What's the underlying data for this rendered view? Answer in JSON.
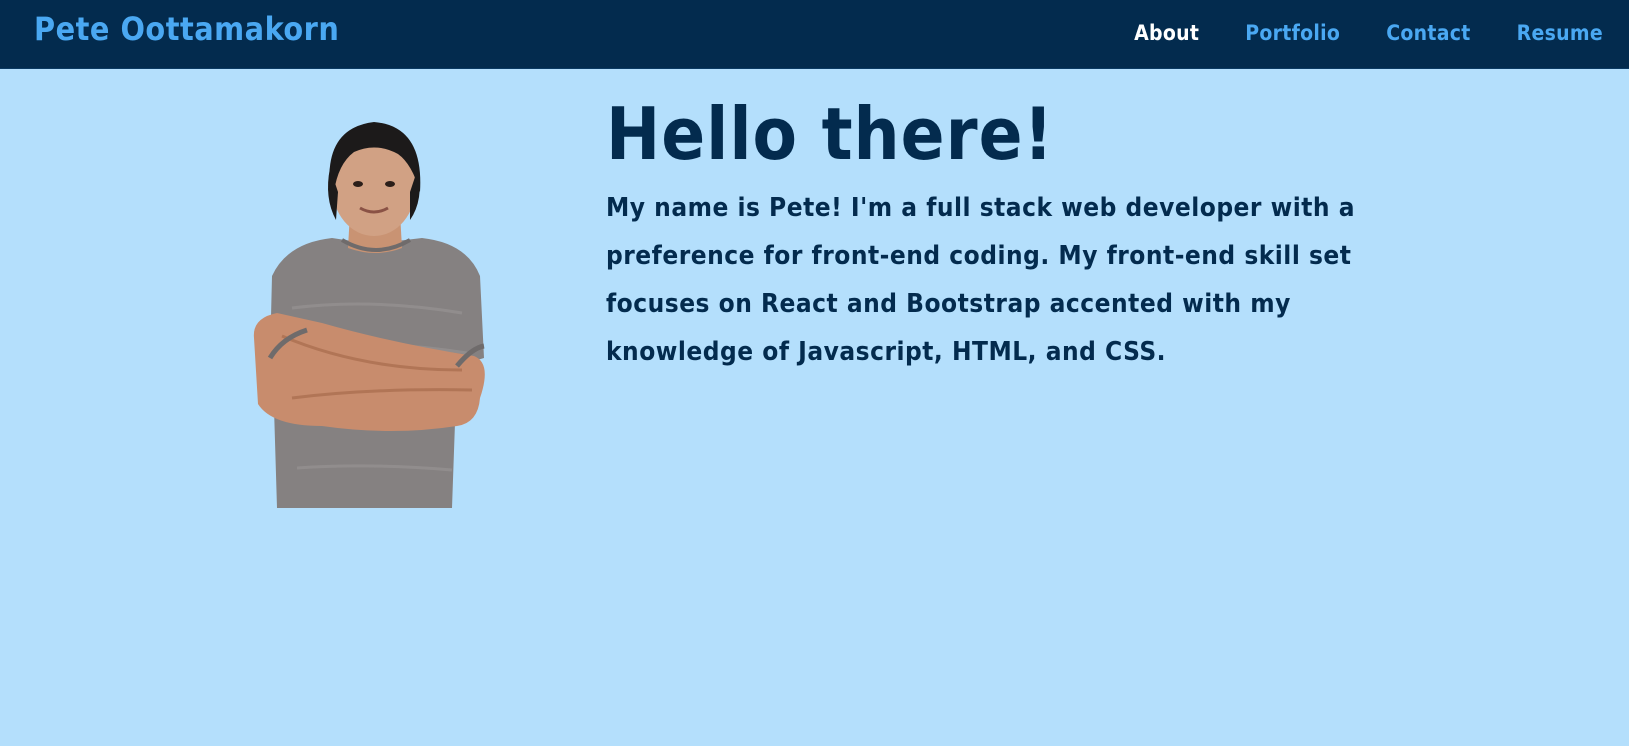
{
  "nav": {
    "brand": "Pete Oottamakorn",
    "links": [
      {
        "label": "About",
        "active": true
      },
      {
        "label": "Portfolio",
        "active": false
      },
      {
        "label": "Contact",
        "active": false
      },
      {
        "label": "Resume",
        "active": false
      }
    ]
  },
  "hero": {
    "heading": "Hello there!",
    "bio": "My name is Pete! I'm a full stack web developer with a preference for front-end coding. My front-end skill set focuses on React and Bootstrap accented with my knowledge of Javascript, HTML, and CSS."
  },
  "colors": {
    "navbar_bg": "#032b4e",
    "page_bg": "#b4dffc",
    "link": "#4aa8f2",
    "active_link": "#ffffff",
    "text": "#032b4e"
  }
}
